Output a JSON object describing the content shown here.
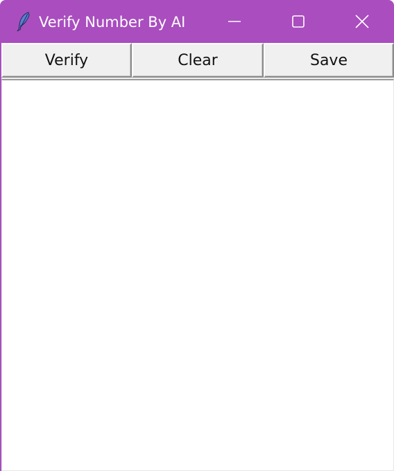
{
  "window": {
    "title": "Verify Number By AI",
    "title_bar_color": "#a94dbf",
    "app_icon": "feather-icon",
    "controls": {
      "minimize_icon": "minimize-icon",
      "maximize_icon": "maximize-icon",
      "close_icon": "close-icon"
    }
  },
  "toolbar": {
    "verify_label": "Verify",
    "clear_label": "Clear",
    "save_label": "Save"
  },
  "editor": {
    "value": ""
  }
}
